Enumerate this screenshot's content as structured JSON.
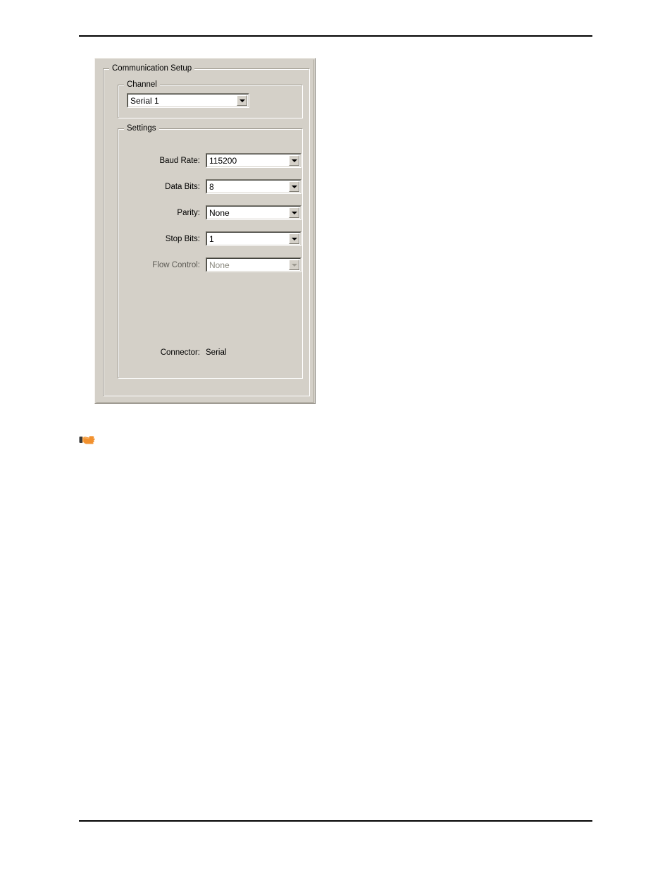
{
  "page": {
    "header_rule": true,
    "footer_rule": true
  },
  "dialog": {
    "groups": {
      "communication_setup": {
        "title": "Communication Setup"
      },
      "channel": {
        "title": "Channel"
      },
      "settings": {
        "title": "Settings"
      }
    },
    "channel": {
      "combo": {
        "name": "channel-combobox",
        "value": "Serial 1",
        "arrow_icon": "chevron-down-icon",
        "enabled": true
      }
    },
    "settings": {
      "rows": [
        {
          "label": "Baud Rate:",
          "value": "115200",
          "arrow_icon": "chevron-down-icon",
          "enabled": true
        },
        {
          "label": "Data Bits:",
          "value": "8",
          "arrow_icon": "chevron-down-icon",
          "enabled": true
        },
        {
          "label": "Parity:",
          "value": "None",
          "arrow_icon": "chevron-down-icon",
          "enabled": true
        },
        {
          "label": "Stop Bits:",
          "value": "1",
          "arrow_icon": "chevron-down-icon",
          "enabled": true
        },
        {
          "label": "Flow Control:",
          "value": "None",
          "arrow_icon": "chevron-down-icon",
          "enabled": false
        }
      ],
      "connector": {
        "label": "Connector:",
        "value": "Serial"
      }
    }
  },
  "note": {
    "icon": "pointing-hand-icon",
    "icon_colors": {
      "hand": "#F2912E",
      "hand_light": "#FBB463",
      "cuff": "#3A3A3A"
    }
  },
  "colors": {
    "dialog_face": "#d4d0c8",
    "field_background": "#ffffff",
    "text": "#000000",
    "disabled_text": "#8c8a80",
    "rule": "#000000"
  }
}
